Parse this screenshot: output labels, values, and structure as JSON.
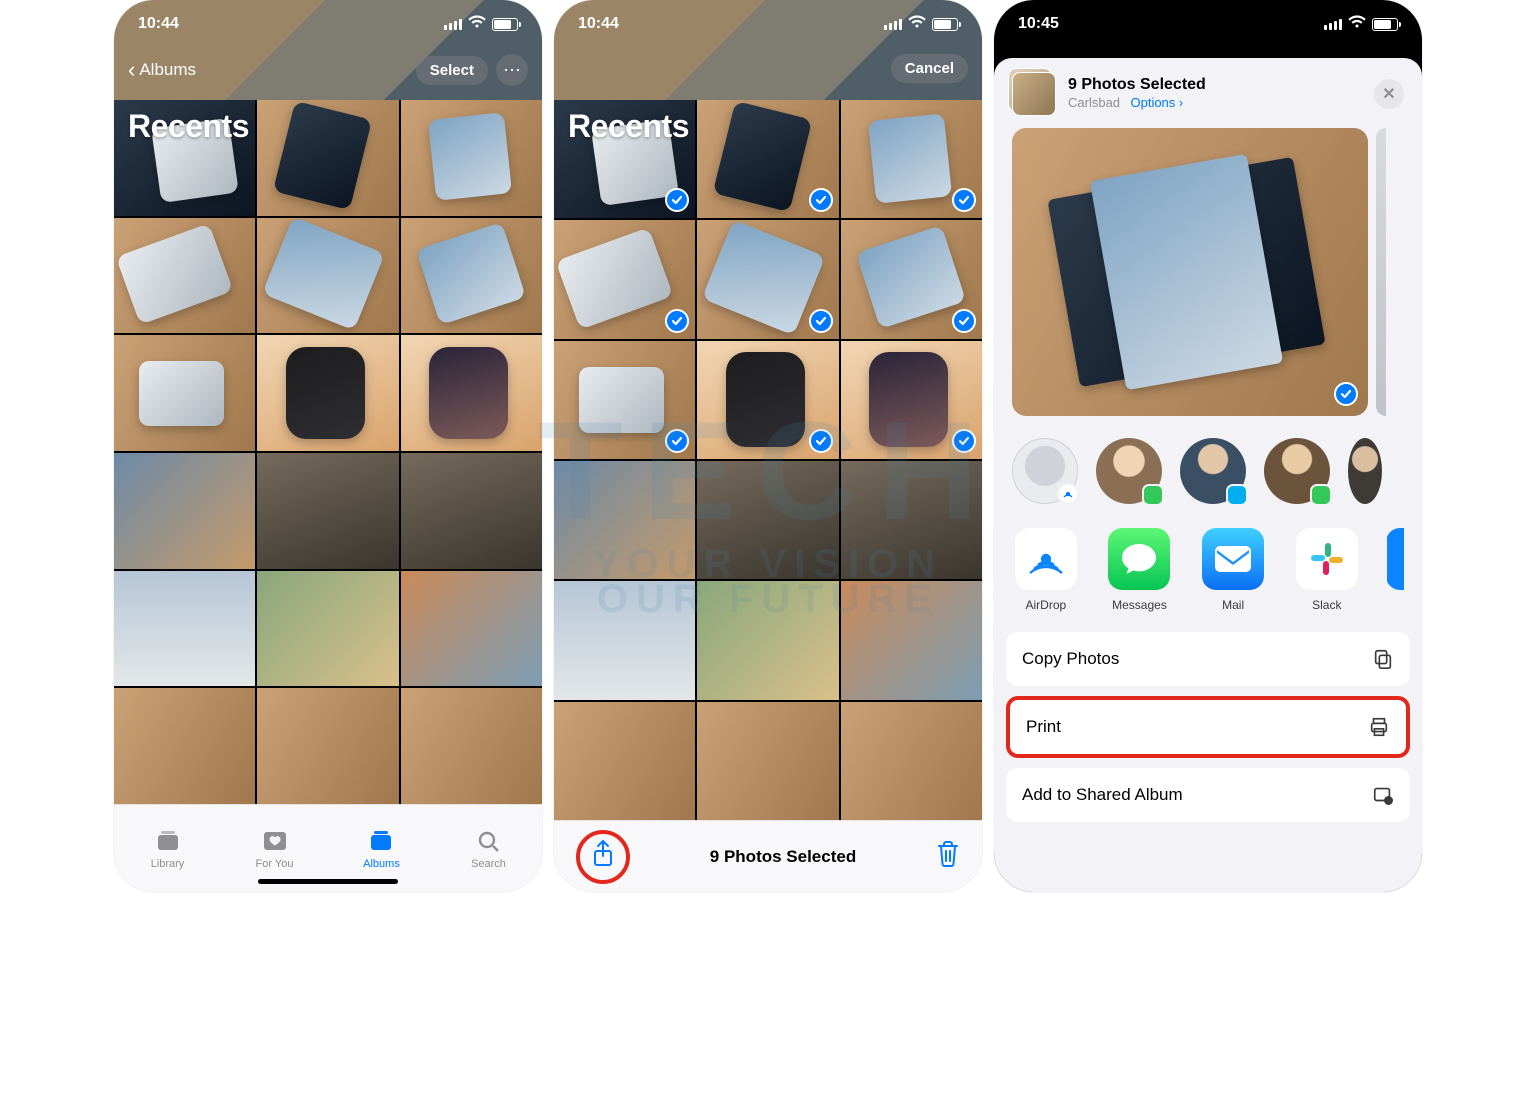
{
  "phone1": {
    "time": "10:44",
    "back_label": "Albums",
    "select_label": "Select",
    "title": "Recents",
    "tabs": {
      "library": "Library",
      "foryou": "For You",
      "albums": "Albums",
      "search": "Search"
    }
  },
  "phone2": {
    "time": "10:44",
    "cancel_label": "Cancel",
    "title": "Recents",
    "selected_label": "9 Photos Selected"
  },
  "phone3": {
    "time": "10:45",
    "selected_title": "9 Photos Selected",
    "location": "Carlsbad",
    "options": "Options",
    "apps": {
      "airdrop": "AirDrop",
      "messages": "Messages",
      "mail": "Mail",
      "slack": "Slack"
    },
    "actions": {
      "copy": "Copy Photos",
      "print": "Print",
      "addshared": "Add to Shared Album"
    }
  },
  "watermark": {
    "big": "TECH",
    "tag1": "YOUR VISION",
    "tag2": "OUR FUTURE"
  }
}
